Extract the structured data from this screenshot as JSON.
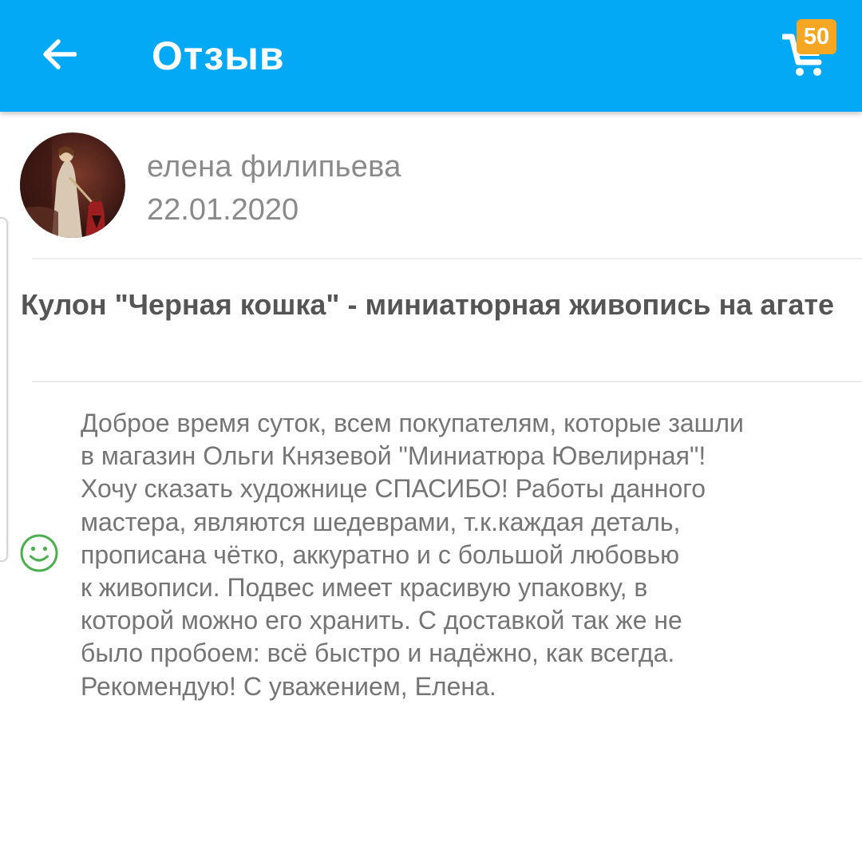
{
  "header": {
    "title": "Отзыв",
    "back_icon": "arrow-left-icon",
    "cart_icon": "shopping-cart-icon",
    "cart_count": "50",
    "colors": {
      "bar": "#03a9f4",
      "badge": "#f5a623"
    }
  },
  "review": {
    "author_name": "елена филипьева",
    "date": "22.01.2020",
    "avatar": "user-avatar-painting",
    "product_title": "Кулон \"Черная кошка\" - миниатюрная живопись на агате",
    "sentiment_icon": "smile-icon",
    "sentiment_color": "#4caf50",
    "text": "Доброе время суток, всем покупателям, которые зашли\nв магазин Ольги Князевой \"Миниатюра Ювелирная\"!\nХочу сказать художнице СПАСИБО! Работы данного\nмастера, являются шедеврами, т.к.каждая деталь,\nпрописана чётко, аккуратно и с большой любовью\nк живописи. Подвес имеет красивую упаковку, в\nкоторой можно его хранить. С доставкой так же не\nбыло пробоем: всё быстро и надёжно, как всегда.\nРекомендую! С уважением, Елена."
  }
}
